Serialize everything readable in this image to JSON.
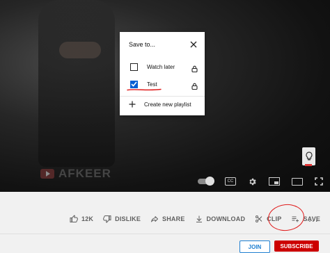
{
  "video": {
    "watermark_text": "AFKEER"
  },
  "player_controls": {
    "icons": [
      "autoplay-toggle-icon",
      "subtitles-icon",
      "settings-icon",
      "miniplayer-icon",
      "theater-mode-icon",
      "fullscreen-icon"
    ]
  },
  "save_dialog": {
    "title": "Save to...",
    "playlists": [
      {
        "label": "Watch later",
        "checked": false,
        "privacy": "lock-icon"
      },
      {
        "label": "Test",
        "checked": true,
        "privacy": "lock-icon"
      }
    ],
    "create_label": "Create new playlist",
    "accent_color": "#065fd4"
  },
  "actions": {
    "like_count": "12K",
    "dislike_label": "DISLIKE",
    "share_label": "SHARE",
    "download_label": "DOWNLOAD",
    "clip_label": "CLIP",
    "save_label": "SAVE",
    "more_label": "..."
  },
  "channel": {
    "join_label": "JOIN",
    "subscribe_label": "SUBSCRIBE"
  },
  "annotation_color": "#e01c1c"
}
